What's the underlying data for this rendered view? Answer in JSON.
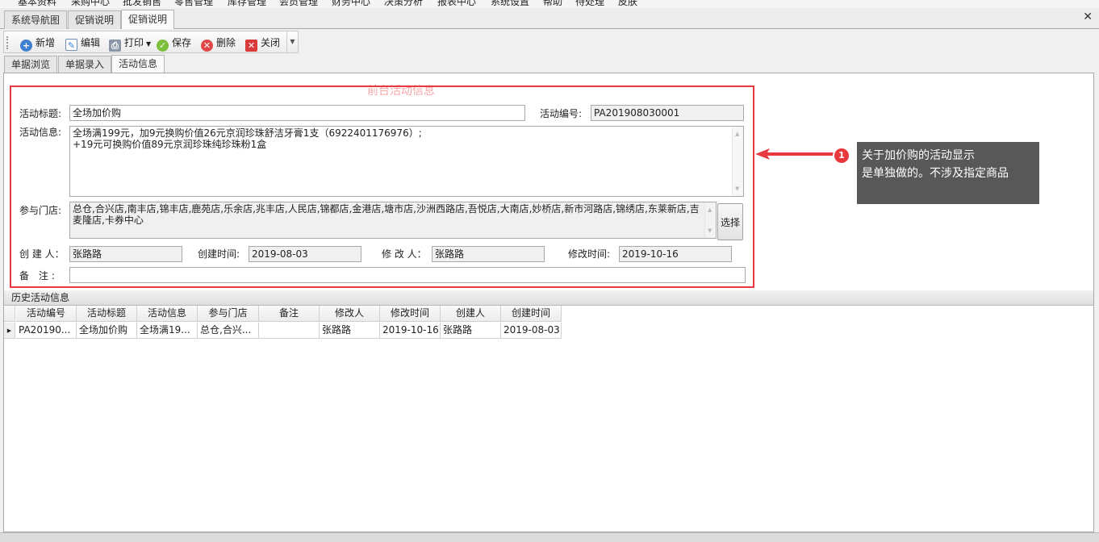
{
  "menu": [
    "基本资料",
    "采购中心",
    "批发销售",
    "零售管理",
    "库存管理",
    "会员管理",
    "财务中心",
    "决策分析",
    "报表中心",
    "系统设置",
    "帮助",
    "待处理",
    "皮肤"
  ],
  "doc_tabs": [
    "系统导航图",
    "促销说明",
    "促销说明"
  ],
  "toolbar": {
    "new_label": "新增",
    "edit_label": "编辑",
    "print_label": "打印",
    "save_label": "保存",
    "delete_label": "删除",
    "close_label": "关闭"
  },
  "inner_tabs": [
    "单据浏览",
    "单据录入",
    "活动信息"
  ],
  "section_title": "前台活动信息",
  "form": {
    "title_label": "活动标题:",
    "title_value": "全场加价购",
    "code_label": "活动编号:",
    "code_value": "PA201908030001",
    "info_label": "活动信息:",
    "info_line1": "全场满199元，加9元换购价值26元京润珍珠舒洁牙膏1支（6922401176976）;",
    "info_line2": "+19元可换购价值89元京润珍珠纯珍珠粉1盒",
    "stores_label": "参与门店:",
    "stores_value": "总仓,合兴店,南丰店,锦丰店,鹿苑店,乐余店,兆丰店,人民店,锦都店,金港店,塘市店,沙洲西路店,吾悦店,大南店,妙桥店,新市河路店,锦绣店,东莱新店,吉麦隆店,卡券中心",
    "select_label": "选择",
    "creator_label": "创 建 人：",
    "creator_value": "张路路",
    "created_label": "创建时间:",
    "created_value": "2019-08-03",
    "modifier_label": "修 改 人：",
    "modifier_value": "张路路",
    "modified_label": "修改时间:",
    "modified_value": "2019-10-16",
    "remark_label": "备 注:",
    "remark_value": ""
  },
  "annotation": {
    "badge": "1",
    "line1": "关于加价购的活动显示",
    "line2": "是单独做的。不涉及指定商品"
  },
  "history": {
    "title": "历史活动信息",
    "columns": [
      "活动编号",
      "活动标题",
      "活动信息",
      "参与门店",
      "备注",
      "修改人",
      "修改时间",
      "创建人",
      "创建时间"
    ],
    "rows": [
      [
        "PA20190...",
        "全场加价购",
        "全场满19...",
        "总仓,合兴...",
        "",
        "张路路",
        "2019-10-16",
        "张路路",
        "2019-08-03"
      ]
    ]
  },
  "colors": {
    "highlight_border": "#e8393e",
    "callout_bg": "#585858"
  }
}
